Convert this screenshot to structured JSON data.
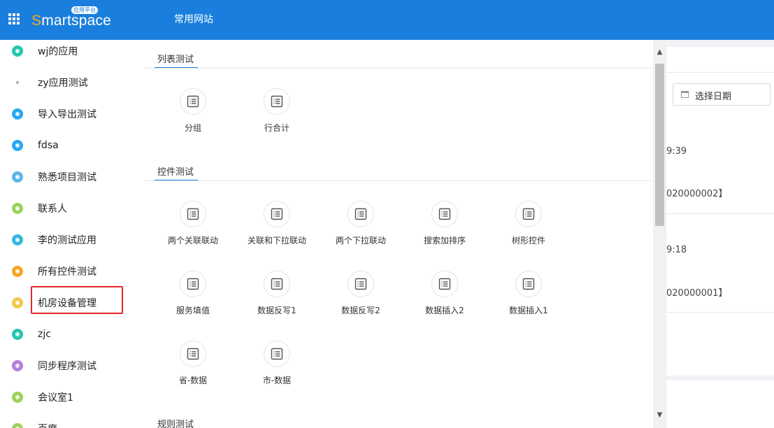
{
  "header": {
    "logo_text": "Smartspace",
    "logo_badge": "应用平台",
    "nav_title": "常用网站"
  },
  "sidebar": {
    "items": [
      {
        "label": "wj的应用",
        "color": "#26c6b0",
        "icon": "app-icon"
      },
      {
        "label": "zy应用测试",
        "color": "#aaaaaa",
        "icon": "dot-icon"
      },
      {
        "label": "导入导出测试",
        "color": "#2aa8f2",
        "icon": "plus-icon"
      },
      {
        "label": "fdsa",
        "color": "#2aa8f2",
        "icon": "plus-icon"
      },
      {
        "label": "熟悉项目测试",
        "color": "#5db8e8",
        "icon": "list-icon"
      },
      {
        "label": "联系人",
        "color": "#9cd35a",
        "icon": "contact-icon"
      },
      {
        "label": "李的测试应用",
        "color": "#3ab7e0",
        "icon": "edit-icon"
      },
      {
        "label": "所有控件测试",
        "color": "#f5a623",
        "icon": "lock-icon"
      },
      {
        "label": "机房设备管理",
        "color": "#f2c94c",
        "icon": "device-icon"
      },
      {
        "label": "zjc",
        "color": "#26c6b0",
        "icon": "robot-icon"
      },
      {
        "label": "同步程序测试",
        "color": "#b57ede",
        "icon": "user-icon"
      },
      {
        "label": "会议室1",
        "color": "#9cd35a",
        "icon": "meeting-icon"
      },
      {
        "label": "百度",
        "color": "#9cd35a",
        "icon": "web-icon"
      }
    ]
  },
  "main": {
    "sections": [
      {
        "title": "列表测试",
        "tiles": [
          "分组",
          "行合计"
        ]
      },
      {
        "title": "控件测试",
        "tiles": [
          "两个关联联动",
          "关联和下拉联动",
          "两个下拉联动",
          "搜索加排序",
          "树形控件",
          "服务填值",
          "数据反写1",
          "数据反写2",
          "数据插入2",
          "数据插入1",
          "省-数据",
          "市-数据"
        ]
      },
      {
        "title": "规则测试",
        "tiles": []
      }
    ]
  },
  "right_panel": {
    "date_placeholder": "选择日期",
    "time1": "9:39",
    "code1": "020000002】",
    "time2": "9:18",
    "code2": "020000001】"
  },
  "colors": {
    "header_bg": "#1a7fdc",
    "accent": "#1a7fdc",
    "highlight": "#e4272c"
  }
}
